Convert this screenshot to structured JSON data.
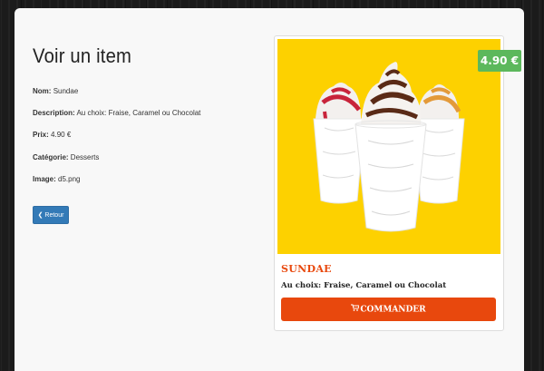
{
  "page": {
    "heading": "Voir un item"
  },
  "item": {
    "name_label": "Nom:",
    "name_value": "Sundae",
    "description_label": "Description:",
    "description_value": "Au choix: Fraise, Caramel ou Chocolat",
    "price_label": "Prix:",
    "price_value": "4.90 €",
    "category_label": "Catégorie:",
    "category_value": "Desserts",
    "image_label": "Image:",
    "image_value": "d5.png"
  },
  "actions": {
    "back_label": "Retour",
    "back_icon": "arrow-left-icon"
  },
  "card": {
    "price_badge": "4.90 €",
    "product_name": "SUNDAE",
    "product_description": "Au choix: Fraise, Caramel ou Chocolat",
    "order_label": "COMMANDER",
    "order_icon": "cart-icon",
    "image_background": "#fdd100",
    "accent_color": "#e8480d",
    "badge_color": "#5cb85c"
  }
}
